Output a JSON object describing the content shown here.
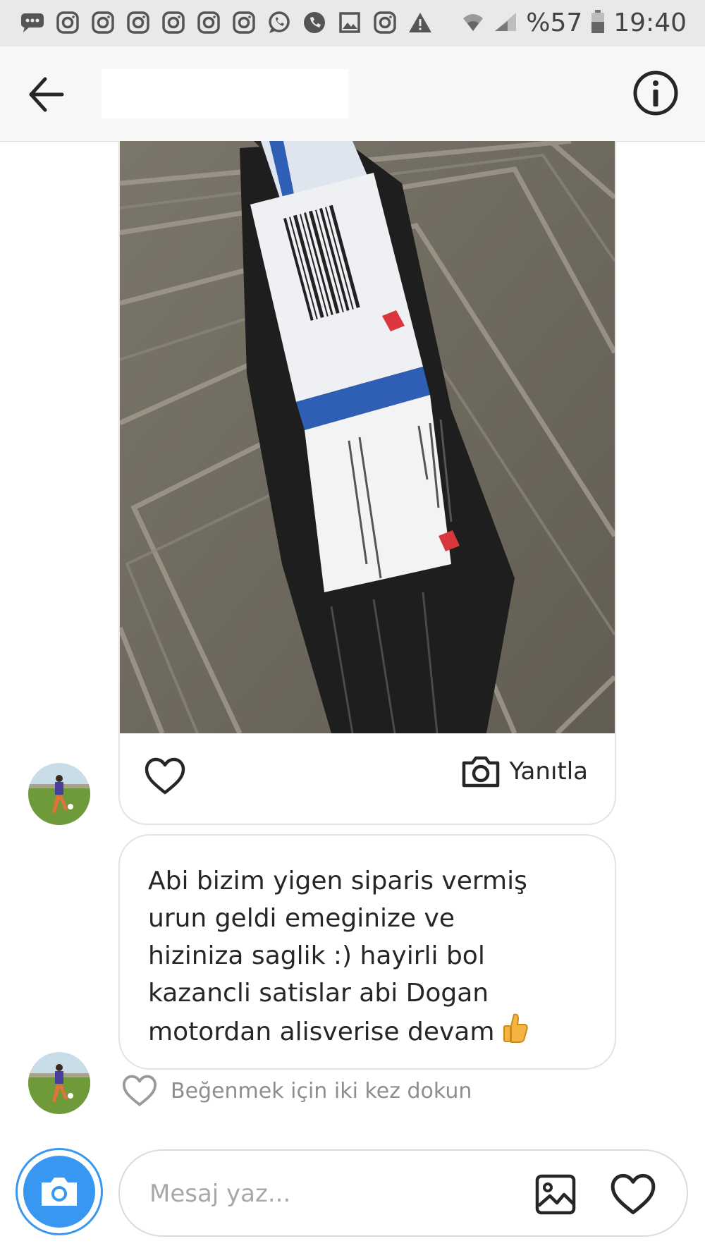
{
  "status_bar": {
    "battery": "%57",
    "time": "19:40",
    "notification_icons": [
      "message-icon",
      "instagram-icon",
      "instagram-icon",
      "instagram-icon",
      "instagram-icon",
      "instagram-icon",
      "whatsapp-icon",
      "phone-icon",
      "image-icon",
      "instagram-icon",
      "warning-icon"
    ]
  },
  "header": {
    "title": "",
    "back_icon": "arrow-left-icon",
    "info_icon": "info-icon"
  },
  "photo_message": {
    "reply_label": "Yanıtla",
    "like_icon": "heart-outline-icon",
    "reply_icon": "camera-icon"
  },
  "text_message": {
    "text": "Abi bizim yigen siparis vermiş\nurun geldi emeginize ve\nhiziniza saglik :) hayirli bol\nkazancli satislar abi Dogan\nmotordan alisverise devam ",
    "emoji": "thumbs-up"
  },
  "double_tap_hint": "Beğenmek için iki kez dokun",
  "composer": {
    "placeholder": "Mesaj yaz...",
    "value": ""
  },
  "colors": {
    "accent": "#3897f0",
    "border": "#e3e3e3",
    "status_bar_bg": "#e9e9e9",
    "header_bg": "#f7f7f7"
  }
}
